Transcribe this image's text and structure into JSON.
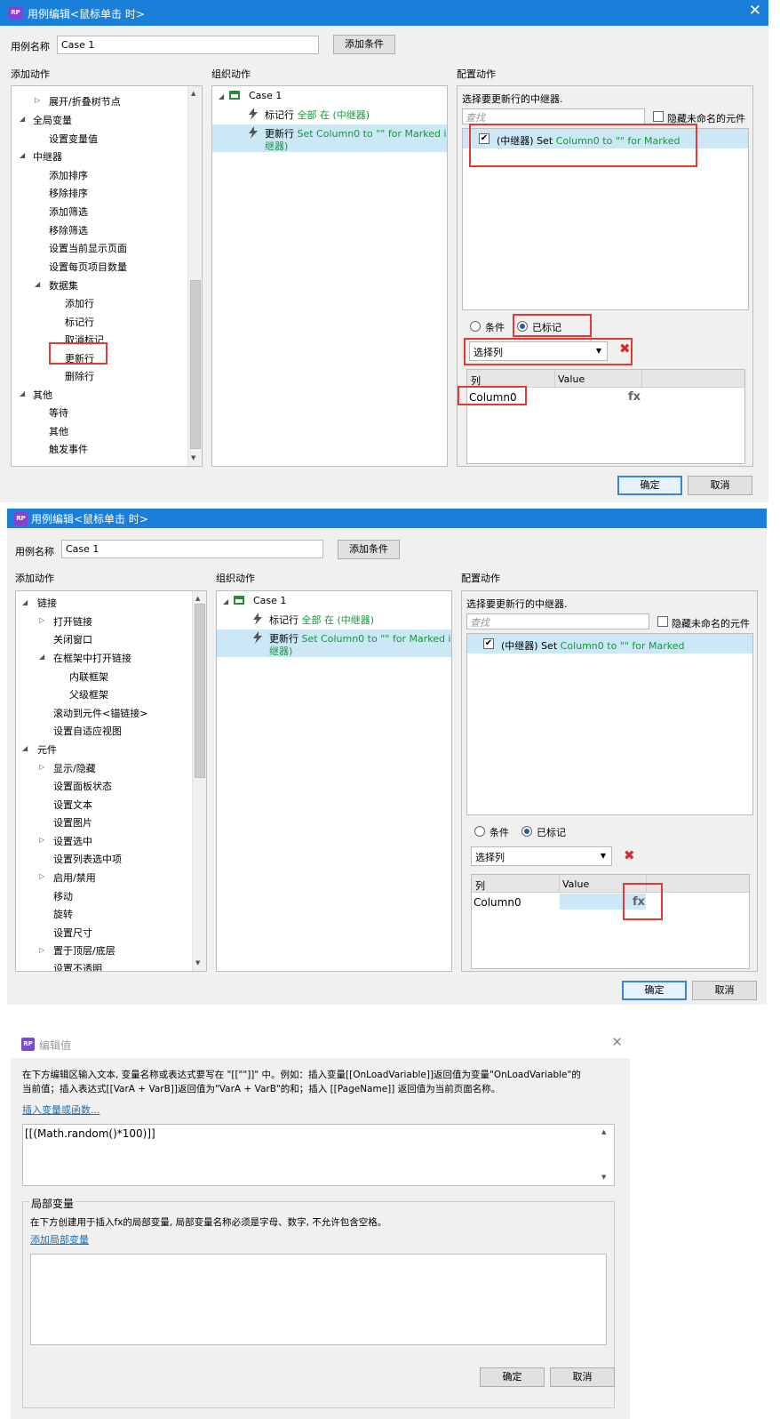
{
  "colors": {
    "titlebar": "#1a7fd8",
    "accent_green": "#18963a",
    "highlight_red": "#e53935",
    "selection": "#cce8f7"
  },
  "dialog1": {
    "title": "用例编辑<鼠标单击 时>",
    "case_name_label": "用例名称",
    "case_name_value": "Case 1",
    "add_condition": "添加条件",
    "col_add_action": "添加动作",
    "col_organize": "组织动作",
    "col_configure": "配置动作",
    "tree": [
      "展开/折叠树节点",
      "全局变量",
      "设置变量值",
      "中继器",
      "添加排序",
      "移除排序",
      "添加筛选",
      "移除筛选",
      "设置当前显示页面",
      "设置每页项目数量",
      "数据集",
      "添加行",
      "标记行",
      "取消标记",
      "更新行",
      "删除行",
      "其他",
      "等待",
      "其他",
      "触发事件"
    ],
    "case_title": "Case 1",
    "action1_name": "标记行",
    "action1_detail": "全部 在 (中继器)",
    "action2_name": "更新行",
    "action2_detail_line1": "Set Column0 to \"\" for Marked in (中",
    "action2_detail_line2": "继器)",
    "select_repeater_label": "选择要更新行的中继器.",
    "search_placeholder": "查找",
    "hide_unnamed": "隐藏未命名的元件",
    "repeater_item_prefix": "(中继器) Set",
    "repeater_item_detail": "Column0 to \"\" for Marked",
    "radio_condition": "条件",
    "radio_marked": "已标记",
    "select_column": "选择列",
    "col_header": "列",
    "value_header": "Value",
    "row_column": "Column0",
    "fx": "fx",
    "ok": "确定",
    "cancel": "取消"
  },
  "dialog2": {
    "title": "用例编辑<鼠标单击 时>",
    "case_name_label": "用例名称",
    "case_name_value": "Case 1",
    "add_condition": "添加条件",
    "col_add_action": "添加动作",
    "col_organize": "组织动作",
    "col_configure": "配置动作",
    "tree": [
      "链接",
      "打开链接",
      "关闭窗口",
      "在框架中打开链接",
      "内联框架",
      "父级框架",
      "滚动到元件<锚链接>",
      "设置自适应视图",
      "元件",
      "显示/隐藏",
      "设置面板状态",
      "设置文本",
      "设置图片",
      "设置选中",
      "设置列表选中项",
      "启用/禁用",
      "移动",
      "旋转",
      "设置尺寸",
      "置于顶层/底层",
      "设置不透明"
    ],
    "case_title": "Case 1",
    "action1_name": "标记行",
    "action1_detail": "全部 在 (中继器)",
    "action2_name": "更新行",
    "action2_detail_line1": "Set Column0 to \"\" for Marked in (中",
    "action2_detail_line2": "继器)",
    "select_repeater_label": "选择要更新行的中继器.",
    "search_placeholder": "查找",
    "hide_unnamed": "隐藏未命名的元件",
    "repeater_item_prefix": "(中继器) Set",
    "repeater_item_detail": "Column0 to \"\" for Marked",
    "radio_condition": "条件",
    "radio_marked": "已标记",
    "select_column": "选择列",
    "col_header": "列",
    "value_header": "Value",
    "row_column": "Column0",
    "fx": "fx",
    "ok": "确定",
    "cancel": "取消"
  },
  "dialog3": {
    "title": "编辑值",
    "description_line1": "在下方编辑区输入文本, 变量名称或表达式要写在 \"[[\"\"]]\" 中。例如：插入变量[[OnLoadVariable]]返回值为变量\"OnLoadVariable\"的",
    "description_line2": "当前值；插入表达式[[VarA + VarB]]返回值为\"VarA + VarB\"的和；插入 [[PageName]] 返回值为当前页面名称。",
    "insert_link": "插入变量或函数...",
    "expression": "[[(Math.random()*100)]]",
    "local_vars_title": "局部变量",
    "local_vars_desc": "在下方创建用于插入fx的局部变量, 局部变量名称必须是字母、数字, 不允许包含空格。",
    "add_local_var": "添加局部变量",
    "ok": "确定",
    "cancel": "取消"
  }
}
